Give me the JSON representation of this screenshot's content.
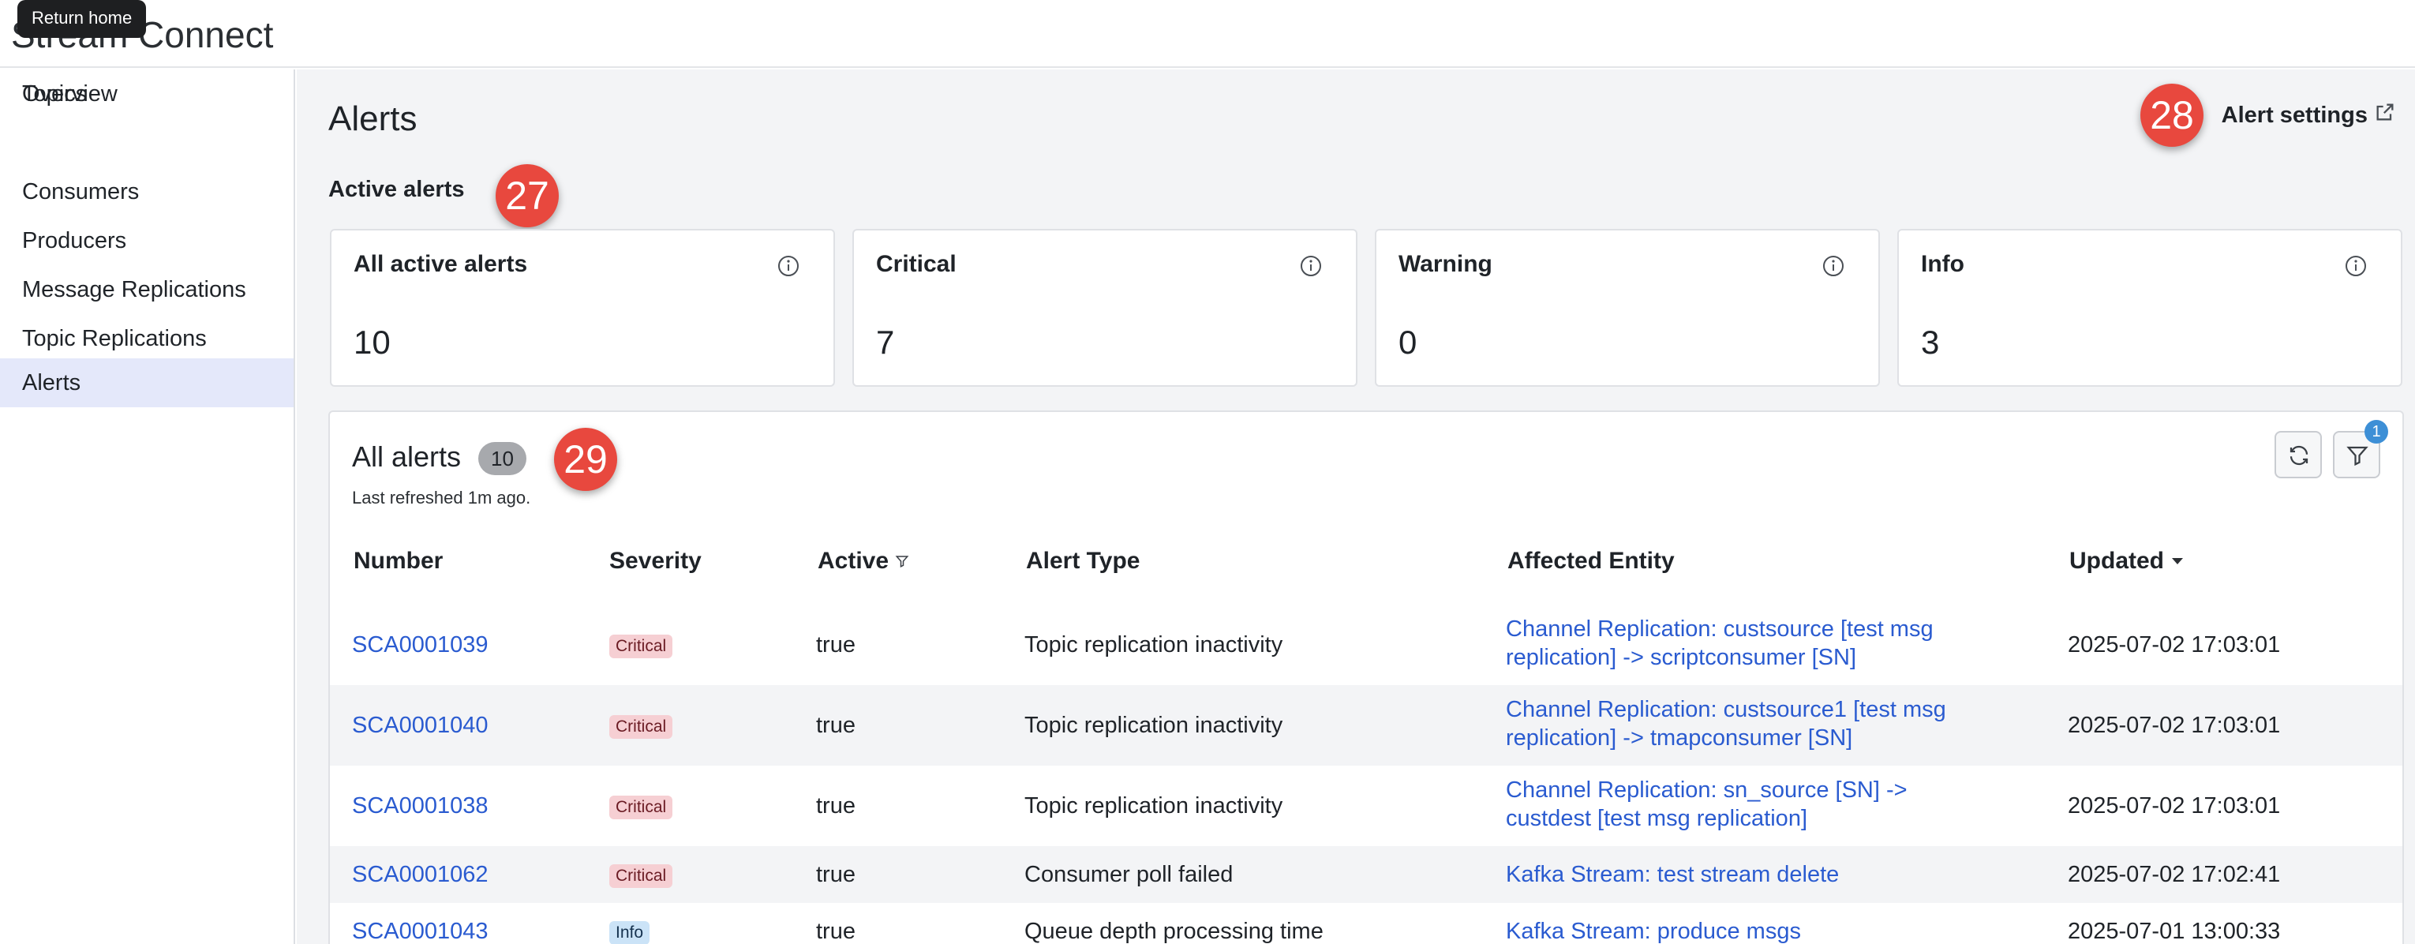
{
  "app": {
    "title": "Stream Connect",
    "tooltip": "Return home"
  },
  "sidebar": {
    "items": [
      {
        "label": "Overview"
      },
      {
        "label": "Topics"
      },
      {
        "label": "Consumers"
      },
      {
        "label": "Producers"
      },
      {
        "label": "Message Replications"
      },
      {
        "label": "Topic Replications"
      },
      {
        "label": "Alerts",
        "active": true
      }
    ]
  },
  "page": {
    "title": "Alerts",
    "settings_label": "Alert settings",
    "section_title": "Active alerts"
  },
  "markers": {
    "m27": "27",
    "m28": "28",
    "m29": "29"
  },
  "cards": [
    {
      "label": "All active alerts",
      "value": "10",
      "icon": "info-circle-icon"
    },
    {
      "label": "Critical",
      "value": "7",
      "icon": "info-circle-icon"
    },
    {
      "label": "Warning",
      "value": "0",
      "icon": "info-circle-icon"
    },
    {
      "label": "Info",
      "value": "3",
      "icon": "info-circle-icon"
    }
  ],
  "alerts_panel": {
    "title": "All alerts",
    "count": "10",
    "last_refreshed": "Last refreshed 1m ago.",
    "filter_count": "1",
    "columns": [
      "Number",
      "Severity",
      "Active",
      "Alert Type",
      "Affected Entity",
      "Updated"
    ],
    "rows": [
      {
        "number": "SCA0001039",
        "severity": "Critical",
        "active": "true",
        "type": "Topic replication inactivity",
        "entity_1": "Channel Replication: custsource [test msg",
        "entity_2": "replication] -> scriptconsumer [SN]",
        "updated": "2025-07-02 17:03:01"
      },
      {
        "number": "SCA0001040",
        "severity": "Critical",
        "active": "true",
        "type": "Topic replication inactivity",
        "entity_1": "Channel Replication: custsource1 [test msg",
        "entity_2": "replication] -> tmapconsumer [SN]",
        "updated": "2025-07-02 17:03:01"
      },
      {
        "number": "SCA0001038",
        "severity": "Critical",
        "active": "true",
        "type": "Topic replication inactivity",
        "entity_1": "Channel Replication: sn_source [SN] ->",
        "entity_2": "custdest [test msg replication]",
        "updated": "2025-07-02 17:03:01"
      },
      {
        "number": "SCA0001062",
        "severity": "Critical",
        "active": "true",
        "type": "Consumer poll failed",
        "entity_1": "Kafka Stream: test stream delete",
        "entity_2": "",
        "updated": "2025-07-02 17:02:41"
      },
      {
        "number": "SCA0001043",
        "severity": "Info",
        "active": "true",
        "type": "Queue depth processing time",
        "entity_1": "Kafka Stream: produce msgs",
        "entity_2": "",
        "updated": "2025-07-01 13:00:33"
      }
    ]
  },
  "colors": {
    "accent_link": "#2a5bd0",
    "marker": "#e8483e",
    "active_nav": "#e4e8fa",
    "critical_badge": "#f6cfd3",
    "info_badge": "#cbe3f7"
  }
}
